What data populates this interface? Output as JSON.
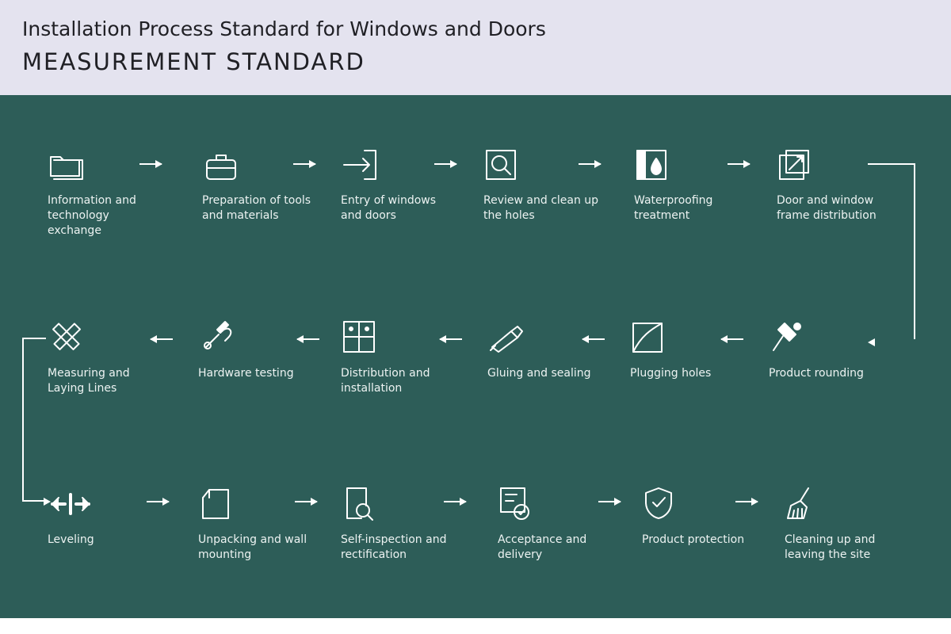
{
  "header": {
    "title": "Installation Process Standard for Windows and Doors",
    "subtitle": "MEASUREMENT STANDARD"
  },
  "steps": [
    {
      "id": 1,
      "label": "Information and technology exchange",
      "icon": "folder"
    },
    {
      "id": 2,
      "label": "Preparation of tools and materials",
      "icon": "briefcase"
    },
    {
      "id": 3,
      "label": "Entry of windows and doors",
      "icon": "door-entry"
    },
    {
      "id": 4,
      "label": "Review and clean up the holes",
      "icon": "magnifier"
    },
    {
      "id": 5,
      "label": "Waterproofing treatment",
      "icon": "waterproof"
    },
    {
      "id": 6,
      "label": "Door and window frame distribution",
      "icon": "frame-dist"
    },
    {
      "id": 7,
      "label": "Measuring and Laying Lines",
      "icon": "ruler-cross"
    },
    {
      "id": 8,
      "label": "Hardware testing",
      "icon": "tools"
    },
    {
      "id": 9,
      "label": "Distribution and installation",
      "icon": "grid"
    },
    {
      "id": 10,
      "label": "Gluing and sealing",
      "icon": "glue"
    },
    {
      "id": 11,
      "label": "Plugging holes",
      "icon": "plug"
    },
    {
      "id": 12,
      "label": "Product rounding",
      "icon": "pin"
    },
    {
      "id": 13,
      "label": "Leveling",
      "icon": "level"
    },
    {
      "id": 14,
      "label": "Unpacking and wall mounting",
      "icon": "unpack"
    },
    {
      "id": 15,
      "label": "Self-inspection and rectification",
      "icon": "inspect"
    },
    {
      "id": 16,
      "label": "Acceptance and delivery",
      "icon": "accept"
    },
    {
      "id": 17,
      "label": "Product protection",
      "icon": "shield"
    },
    {
      "id": 18,
      "label": "Cleaning up and leaving the site",
      "icon": "broom"
    }
  ]
}
